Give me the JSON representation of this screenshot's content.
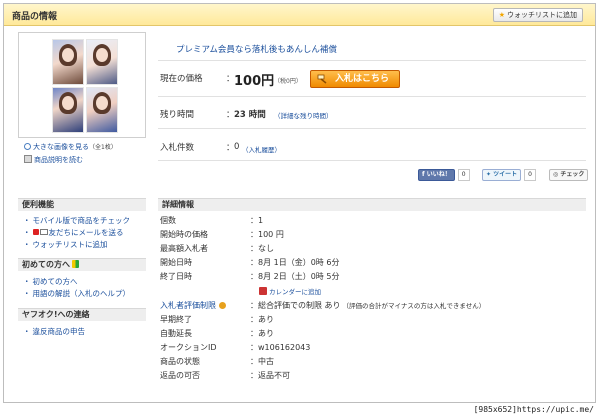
{
  "header": {
    "title": "商品の情報",
    "watchlist_button": "ウォッチリストに追加"
  },
  "image_panel": {
    "enlarge_link": "大きな画像を見る",
    "image_count": "（全1枚）",
    "description_link": "商品説明を読む"
  },
  "summary": {
    "premium_notice": "プレミアム会員なら落札後もあんしん補償",
    "price_label": "現在の価格",
    "price_value": "100円",
    "price_tax": "（税0円）",
    "bid_button": "入札はこちら",
    "time_label": "残り時間",
    "time_value": "23 時間",
    "time_detail_link": "（詳細な残り時間）",
    "bids_label": "入札件数",
    "bids_value": "0",
    "bid_history_link": "（入札履歴）"
  },
  "social": {
    "like_label": "いいね！",
    "like_count": "0",
    "tweet_label": "ツイート",
    "tweet_count": "0",
    "check_label": "チェック"
  },
  "sidebar": {
    "sections": [
      {
        "title": "便利機能",
        "items": [
          "モバイル版で商品をチェック",
          "友だちにメールを送る",
          "ウォッチリストに追加"
        ]
      },
      {
        "title": "初めての方へ",
        "items": [
          "初めての方へ",
          "用語の解説（入札のヘルプ）"
        ]
      },
      {
        "title": "ヤフオク!への連絡",
        "items": [
          "違反商品の申告"
        ]
      }
    ]
  },
  "details": {
    "title": "詳細情報",
    "rows": [
      {
        "label": "個数",
        "value": "1"
      },
      {
        "label": "開始時の価格",
        "value": "100 円"
      },
      {
        "label": "最高額入札者",
        "value": "なし"
      },
      {
        "label": "開始日時",
        "value": "8月 1日（金）0時 6分"
      },
      {
        "label": "終了日時",
        "value": "8月 2日（土）0時 5分"
      },
      {
        "label": "入札者評価制限",
        "value": "総合評価での制限 あり",
        "note": "（評価の合計がマイナスの方は入札できません）"
      },
      {
        "label": "早期終了",
        "value": "あり"
      },
      {
        "label": "自動延長",
        "value": "あり"
      },
      {
        "label": "オークションID",
        "value": "w106162043"
      },
      {
        "label": "商品の状態",
        "value": "中古"
      },
      {
        "label": "返品の可否",
        "value": "返品不可"
      }
    ],
    "calendar_link": "カレンダーに追加"
  },
  "watermark": "[985x652]https://upic.me/",
  "colors": {
    "header_bg": "#ffe99a",
    "link": "#1b4f9c",
    "bid_button": "#f08a00"
  }
}
